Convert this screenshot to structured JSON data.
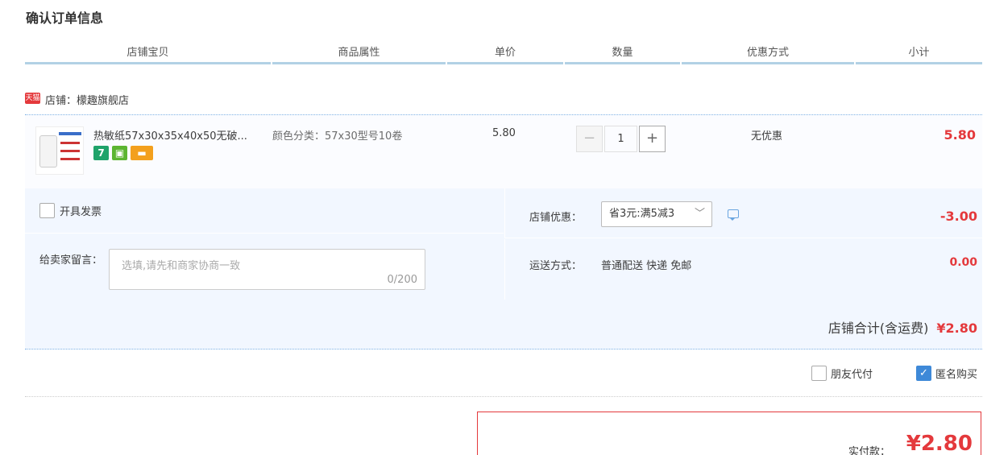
{
  "page": {
    "title": "确认订单信息"
  },
  "columns": [
    "店铺宝贝",
    "商品属性",
    "单价",
    "数量",
    "优惠方式",
    "小计"
  ],
  "shop": {
    "badge": "天猫",
    "label": "店铺：檬趣旗舰店"
  },
  "item": {
    "title": "热敏纸57x30x35x40x50无破...",
    "attr": "颜色分类：57x30型号10卷",
    "price": "5.80",
    "quantity": "1",
    "minus": "−",
    "plus": "+",
    "promo": "无优惠",
    "subtotal": "5.80",
    "service_icons": [
      {
        "name": "seven-day-return-icon",
        "text": "7",
        "color": "#1fa36a"
      },
      {
        "name": "quality-guarantee-icon",
        "text": "",
        "color": "#5cb531"
      },
      {
        "name": "card-payment-icon",
        "text": "",
        "color": "#f3a01d"
      }
    ]
  },
  "options": {
    "invoice_label": "开具发票",
    "message_label": "给卖家留言：",
    "message_placeholder": "选填,请先和商家协商一致",
    "message_count": "0/200",
    "shop_promo_label": "店铺优惠：",
    "shop_promo_value": "省3元:满5减3",
    "shop_promo_chevron": "﹀",
    "discount": "-3.00",
    "shipping_label": "运送方式：",
    "shipping_value": "普通配送 快递 免邮",
    "shipping_fee": "0.00",
    "total_label": "店铺合计(含运费)",
    "total_value": "¥2.80"
  },
  "payment": {
    "friend_pay": "朋友代付",
    "anonymous": "匿名购买",
    "actual_label": "实付款：",
    "actual_value": "¥2.80"
  },
  "colors": {
    "accent": "#e4393c",
    "header_border": "#b2d1e5",
    "panel_bg": "#f2f7ff",
    "check_blue": "#3e89d8"
  }
}
